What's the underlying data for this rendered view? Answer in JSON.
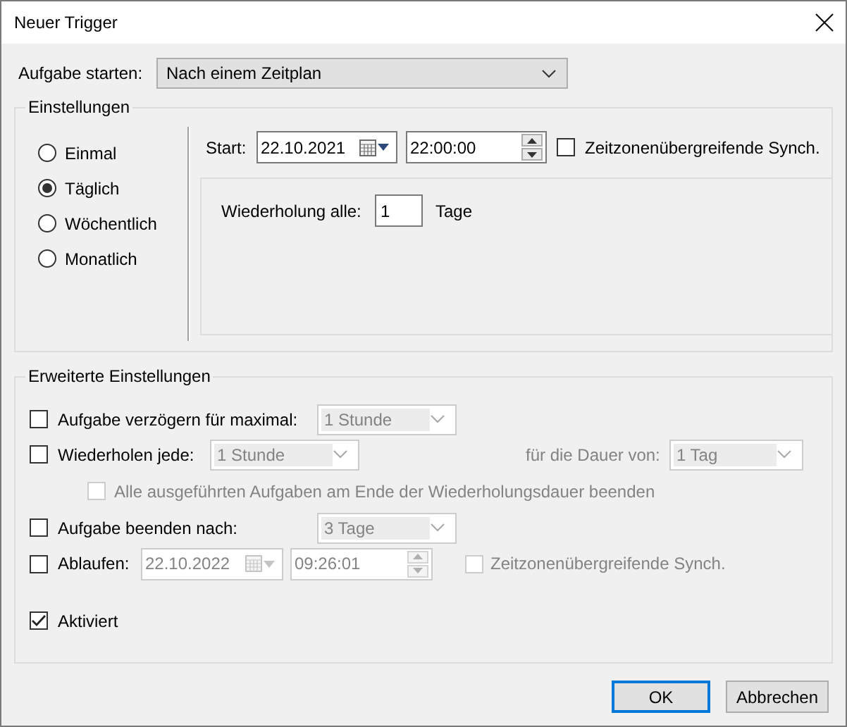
{
  "window": {
    "title": "Neuer Trigger"
  },
  "start_task": {
    "label": "Aufgabe starten:",
    "value": "Nach einem Zeitplan"
  },
  "settings": {
    "title": "Einstellungen",
    "schedule": [
      {
        "label": "Einmal",
        "selected": false
      },
      {
        "label": "Täglich",
        "selected": true
      },
      {
        "label": "Wöchentlich",
        "selected": false
      },
      {
        "label": "Monatlich",
        "selected": false
      }
    ],
    "start": {
      "label": "Start:",
      "date": "22.10.2021",
      "time": "22:00:00"
    },
    "sync": {
      "label": "Zeitzonenübergreifende Synch.",
      "checked": false
    },
    "recurrence": {
      "label": "Wiederholung alle:",
      "value": "1",
      "unit": "Tage"
    }
  },
  "advanced": {
    "title": "Erweiterte Einstellungen",
    "delay": {
      "label": "Aufgabe verzögern für maximal:",
      "checked": false,
      "value": "1 Stunde",
      "disabled": true
    },
    "repeat": {
      "label": "Wiederholen jede:",
      "checked": false,
      "value": "1 Stunde",
      "disabled": true,
      "duration_label": "für die Dauer von:",
      "duration": "1 Tag"
    },
    "stop_all": {
      "label": "Alle ausgeführten Aufgaben am Ende der Wiederholungsdauer beenden",
      "checked": false,
      "disabled": true
    },
    "stop_after": {
      "label": "Aufgabe beenden nach:",
      "checked": false,
      "value": "3 Tage",
      "disabled": true
    },
    "expire": {
      "label": "Ablaufen:",
      "checked": false,
      "date": "22.10.2022",
      "time": "09:26:01",
      "disabled": true,
      "sync_label": "Zeitzonenübergreifende Synch.",
      "sync_checked": false
    },
    "enabled": {
      "label": "Aktiviert",
      "checked": true
    }
  },
  "buttons": [
    {
      "label": "OK",
      "default": true
    },
    {
      "label": "Abbrechen",
      "default": false
    }
  ]
}
